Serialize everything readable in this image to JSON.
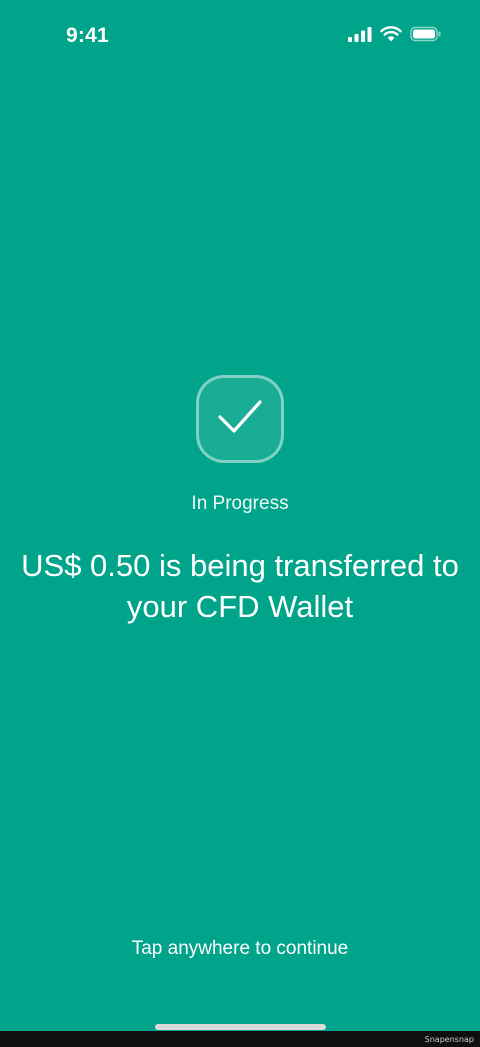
{
  "status_bar": {
    "time": "9:41",
    "icons": [
      "cellular-signal-icon",
      "wifi-icon",
      "battery-icon"
    ]
  },
  "transfer": {
    "status_icon": "checkmark-icon",
    "status_label": "In Progress",
    "message": "US$ 0.50 is being transferred to your CFD Wallet"
  },
  "continue_hint": "Tap anywhere to continue",
  "watermark": "Snapensnap",
  "colors": {
    "background": "#00A48A",
    "text": "#FFFFFF"
  }
}
